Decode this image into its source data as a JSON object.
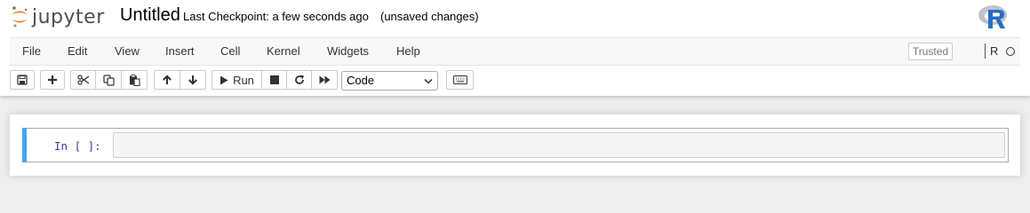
{
  "header": {
    "logo_text": "jupyter",
    "notebook_name": "Untitled",
    "checkpoint": "Last Checkpoint: a few seconds ago",
    "autosave_status": "(unsaved changes)"
  },
  "menubar": {
    "items": [
      "File",
      "Edit",
      "View",
      "Insert",
      "Cell",
      "Kernel",
      "Widgets",
      "Help"
    ],
    "trusted_label": "Trusted",
    "kernel_name": "R"
  },
  "toolbar": {
    "run_label": "Run",
    "cell_type": "Code",
    "cell_type_options": [
      "Code"
    ]
  },
  "cell": {
    "prompt": "In [ ]:",
    "source": ""
  },
  "colors": {
    "jupyter_orange": "#f37726",
    "selected_cell_bar": "#42a5f5",
    "prompt_blue": "#303f9f"
  }
}
